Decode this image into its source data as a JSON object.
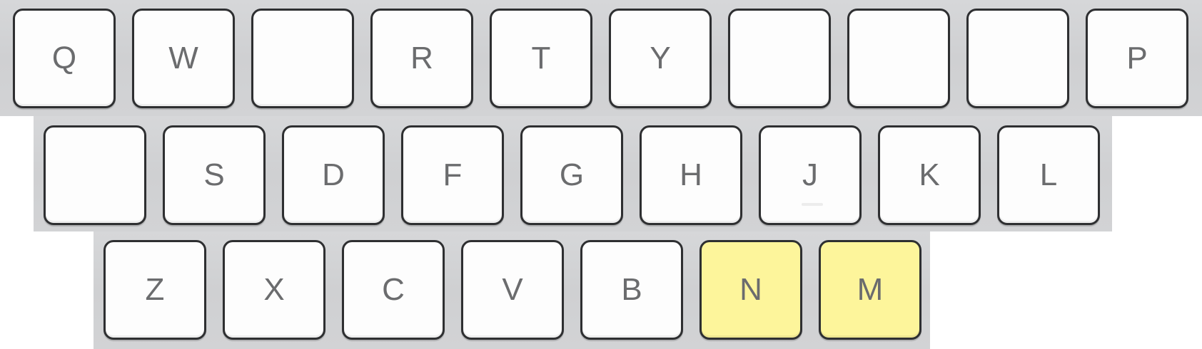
{
  "keyboard": {
    "highlight_color": "#fdf59b",
    "row1": [
      "Q",
      "W",
      "",
      "R",
      "T",
      "Y",
      "",
      "",
      "",
      "P"
    ],
    "row2": [
      "",
      "S",
      "D",
      "F",
      "G",
      "H",
      "J",
      "K",
      "L"
    ],
    "row3": [
      "Z",
      "X",
      "C",
      "V",
      "B",
      "N",
      "M"
    ],
    "highlighted_keys": [
      "N",
      "M"
    ]
  }
}
